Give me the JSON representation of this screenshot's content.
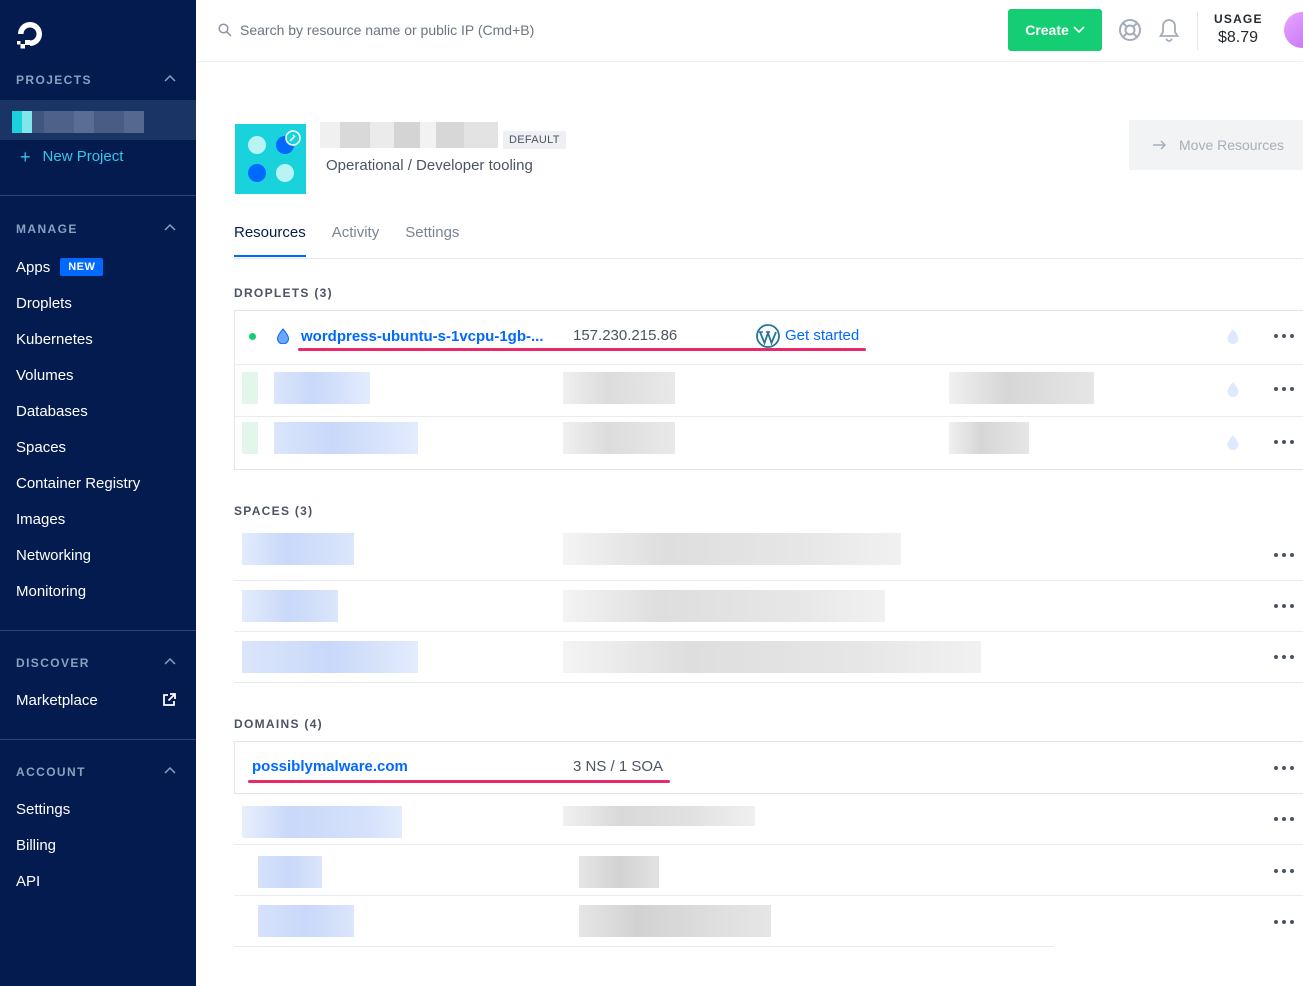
{
  "search": {
    "placeholder": "Search by resource name or public IP (Cmd+B)"
  },
  "topbar": {
    "create_label": "Create",
    "usage_label": "USAGE",
    "usage_value": "$8.79"
  },
  "sidebar": {
    "projects_title": "PROJECTS",
    "new_project": "New Project",
    "manage_title": "MANAGE",
    "manage_items": [
      "Apps",
      "Droplets",
      "Kubernetes",
      "Volumes",
      "Databases",
      "Spaces",
      "Container Registry",
      "Images",
      "Networking",
      "Monitoring"
    ],
    "apps_badge": "NEW",
    "discover_title": "DISCOVER",
    "discover_items": [
      "Marketplace"
    ],
    "account_title": "ACCOUNT",
    "account_items": [
      "Settings",
      "Billing",
      "API"
    ]
  },
  "project": {
    "default_badge": "DEFAULT",
    "purpose": "Operational / Developer tooling",
    "move_label": "Move Resources"
  },
  "tabs": [
    "Resources",
    "Activity",
    "Settings"
  ],
  "droplets": {
    "title": "DROPLETS (3)",
    "first": {
      "name": "wordpress-ubuntu-s-1vcpu-1gb-...",
      "ip": "157.230.215.86",
      "action": "Get started"
    }
  },
  "spaces": {
    "title": "SPACES (3)"
  },
  "domains": {
    "title": "DOMAINS (4)",
    "first": {
      "name": "possiblymalware.com",
      "records": "3 NS / 1 SOA"
    }
  },
  "colors": {
    "sidebar": "#031b4e",
    "accent": "#0069ff",
    "create": "#15cd72",
    "highlight": "#e8296a"
  }
}
